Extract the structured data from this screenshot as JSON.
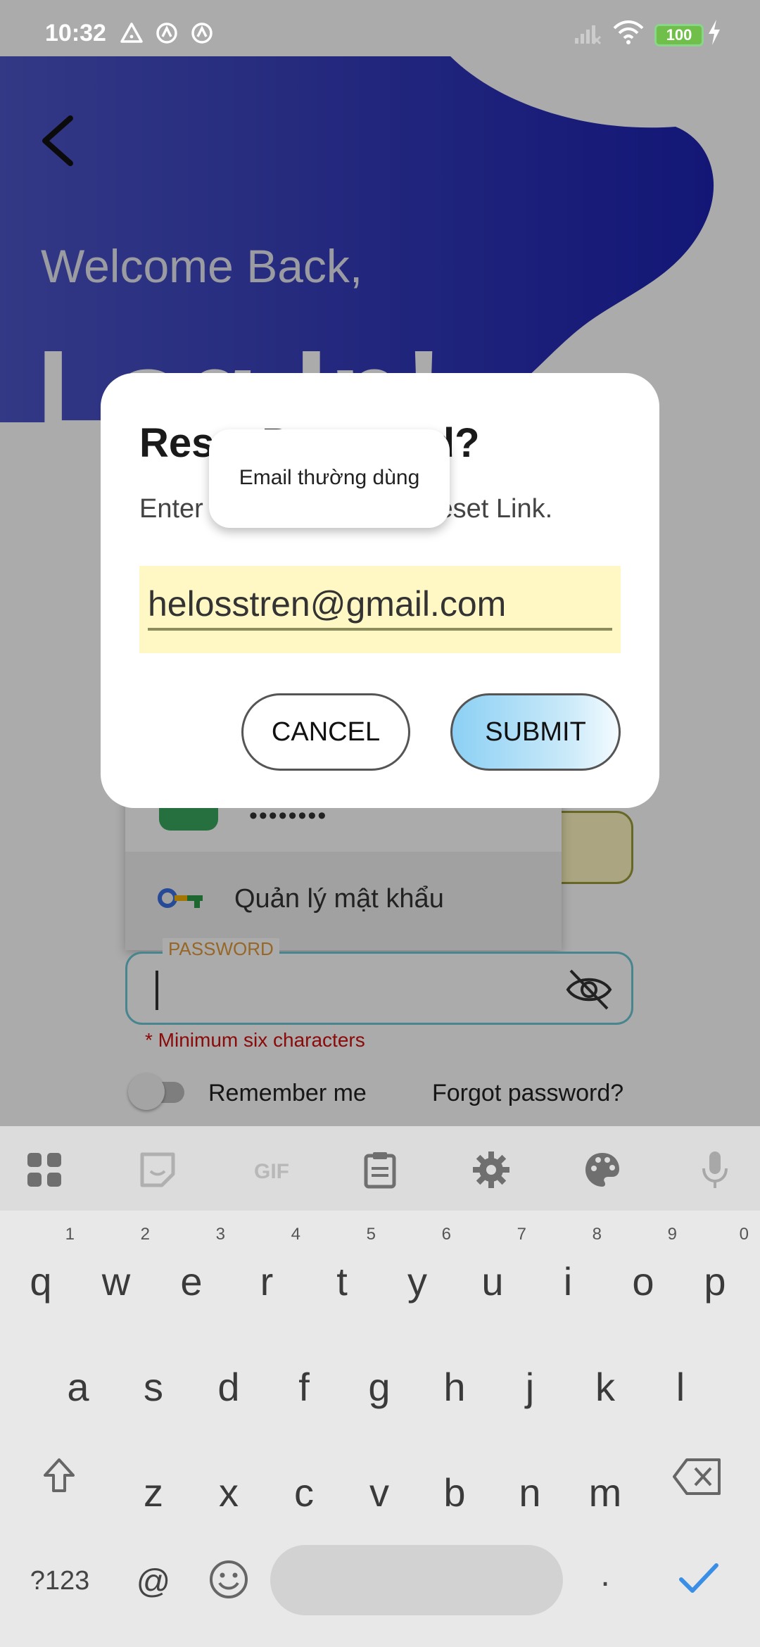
{
  "status_bar": {
    "time": "10:32",
    "battery": "100"
  },
  "login": {
    "welcome": "Welcome Back,",
    "heading": "Log In!",
    "password_label": "PASSWORD",
    "password_hint": "* Minimum six characters",
    "remember_label": "Remember me",
    "forgot_link": "Forgot password?",
    "autofill_masked": "••••••••",
    "autofill_manager": "Quản lý mật khẩu"
  },
  "dialog": {
    "title": "Reset Password?",
    "description": "Enter Email to Receive Reset Link.",
    "email_value": "helosstren@gmail.com",
    "cancel_label": "CANCEL",
    "submit_label": "SUBMIT"
  },
  "tooltip": {
    "text": "Email thường dùng"
  },
  "keyboard": {
    "toolbar": [
      "apps-icon",
      "sticker-icon",
      "gif-icon",
      "clipboard-icon",
      "settings-icon",
      "palette-icon",
      "mic-icon"
    ],
    "row1": [
      "q",
      "w",
      "e",
      "r",
      "t",
      "y",
      "u",
      "i",
      "o",
      "p"
    ],
    "row1_nums": [
      "1",
      "2",
      "3",
      "4",
      "5",
      "6",
      "7",
      "8",
      "9",
      "0"
    ],
    "row2": [
      "a",
      "s",
      "d",
      "f",
      "g",
      "h",
      "j",
      "k",
      "l"
    ],
    "row3": [
      "z",
      "x",
      "c",
      "v",
      "b",
      "n",
      "m"
    ],
    "symbols_label": "?123",
    "at_label": "@",
    "period_label": "."
  },
  "colors": {
    "blob": "#2b2fb3",
    "dialog": "#ffffff",
    "submit_gradient": "#8cd0f4"
  }
}
